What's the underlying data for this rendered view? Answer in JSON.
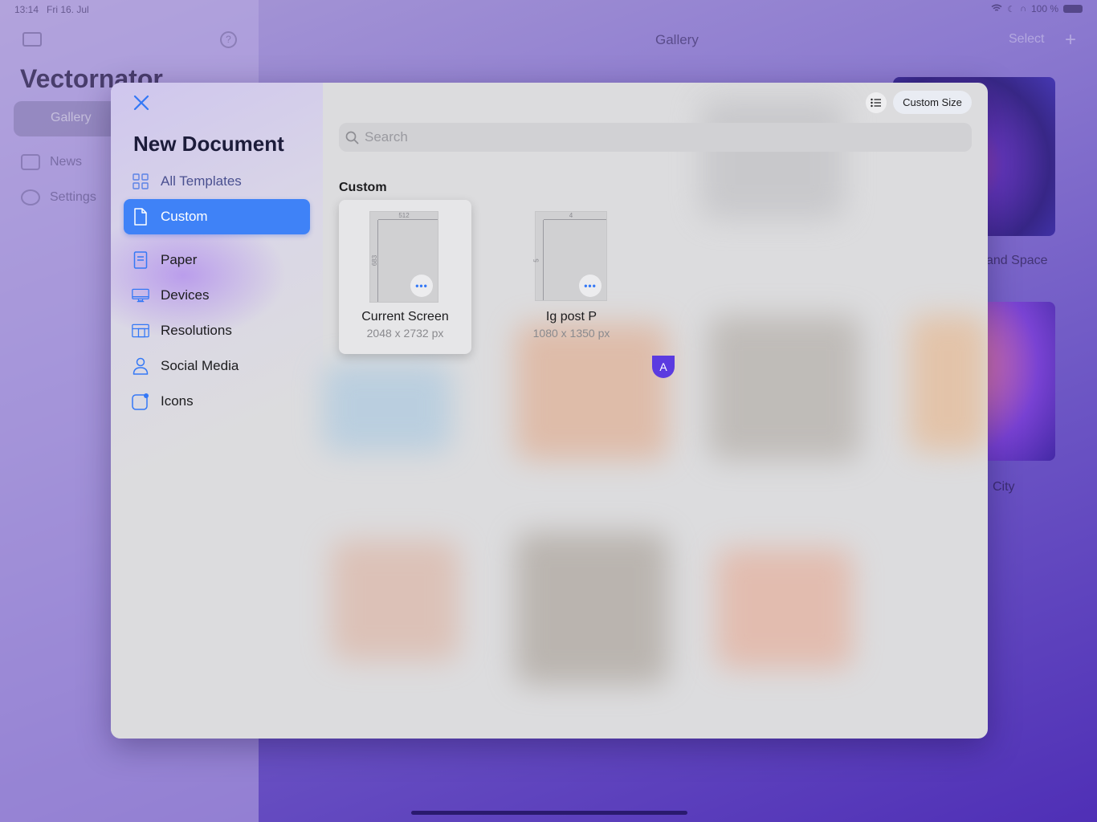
{
  "status_bar": {
    "time": "13:14",
    "date": "Fri 16. Jul",
    "battery": "100 %"
  },
  "background_app": {
    "title": "Vectornator",
    "nav": [
      {
        "label": "Gallery"
      },
      {
        "label": "News"
      },
      {
        "label": "Settings"
      }
    ],
    "header_title": "Gallery",
    "select_label": "Select",
    "gallery_labels": [
      "and Space",
      "City"
    ]
  },
  "modal": {
    "title": "New Document",
    "close_label": "Close",
    "custom_size_label": "Custom Size",
    "search_placeholder": "Search",
    "sidebar": [
      {
        "label": "All Templates",
        "icon": "grid-icon"
      },
      {
        "label": "Custom",
        "icon": "document-icon"
      },
      {
        "label": "Paper",
        "icon": "paper-icon"
      },
      {
        "label": "Devices",
        "icon": "monitor-icon"
      },
      {
        "label": "Resolutions",
        "icon": "resolution-icon"
      },
      {
        "label": "Social Media",
        "icon": "person-icon"
      },
      {
        "label": "Icons",
        "icon": "app-icon"
      }
    ],
    "section_title": "Custom",
    "templates": [
      {
        "name": "Current Screen",
        "size": "2048 x 2732 px",
        "dim_w": "512",
        "dim_h": "683"
      },
      {
        "name": "Ig post P",
        "size": "1080 x 1350 px",
        "dim_w": "4",
        "dim_h": "5"
      }
    ],
    "badge": "A"
  },
  "colors": {
    "accent": "#3f82f7",
    "badge": "#5b3be0",
    "title": "#1c1c3a"
  }
}
